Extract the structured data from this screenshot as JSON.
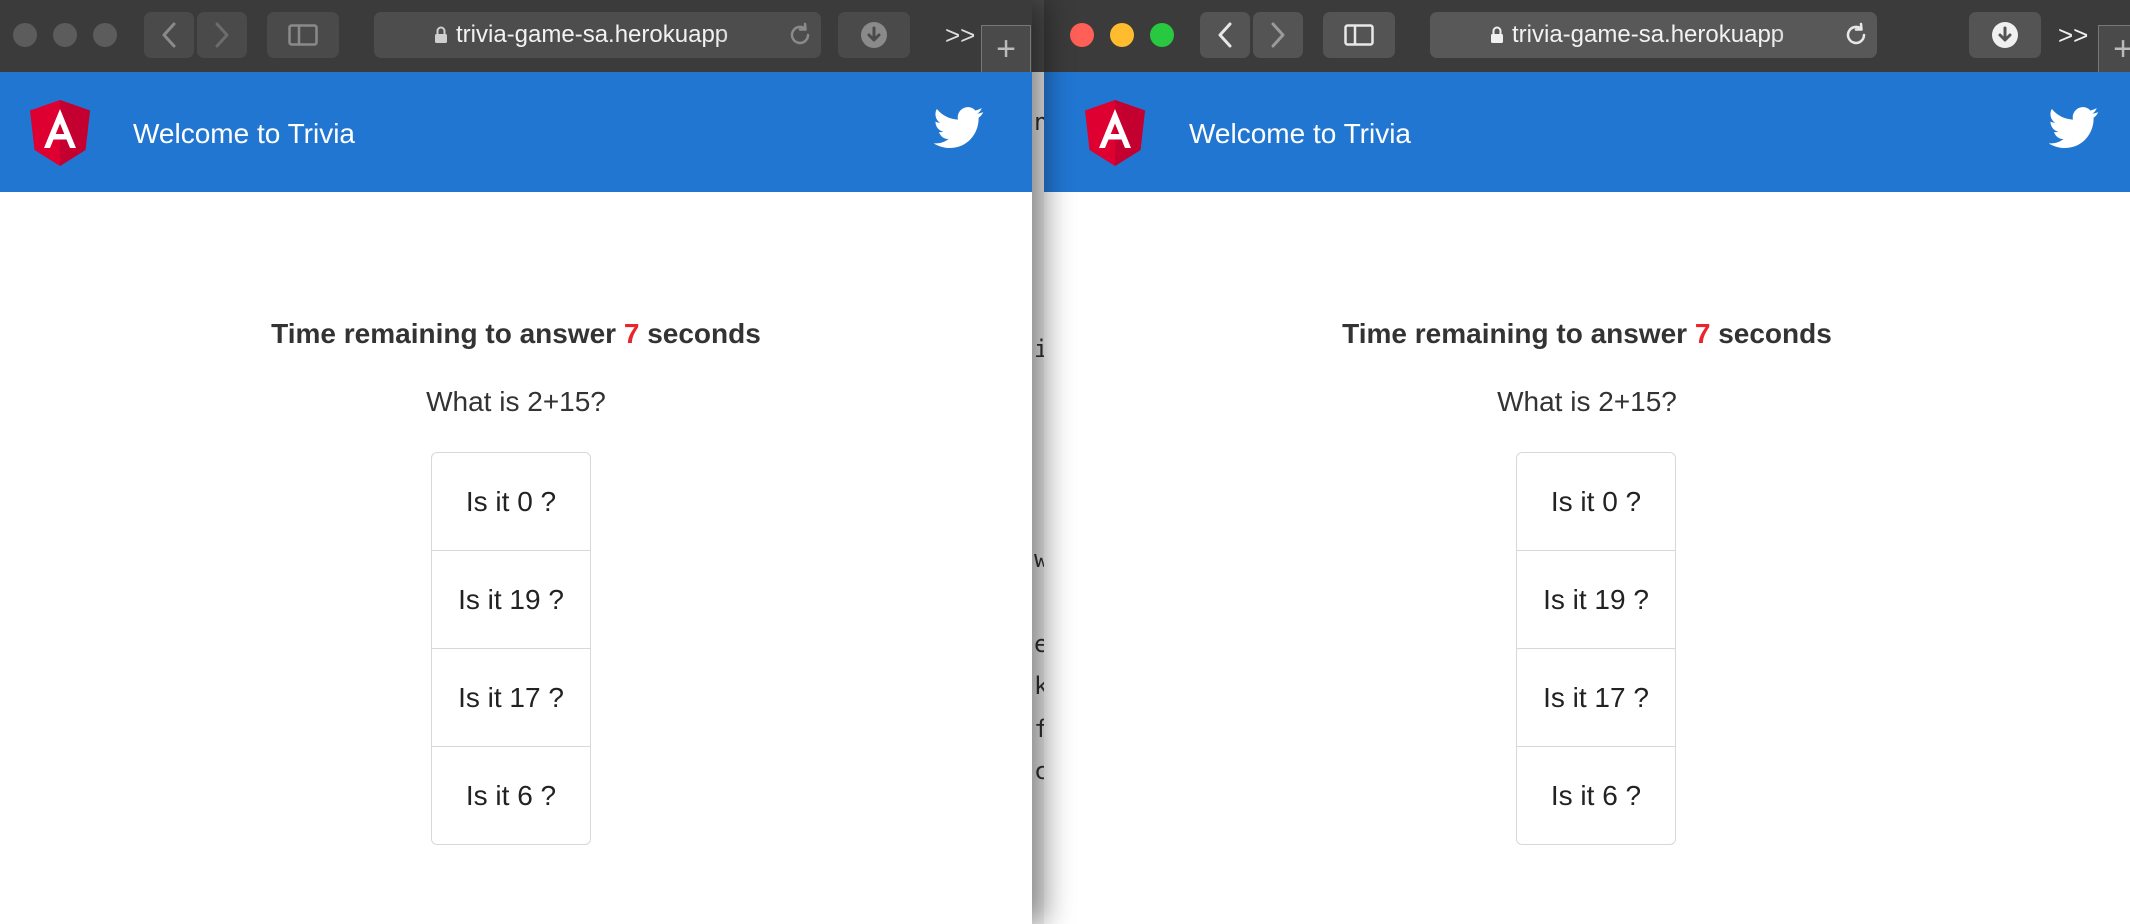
{
  "browser": {
    "url": "trivia-game-sa.herokuapp",
    "more_label": ">>",
    "new_tab_label": "+"
  },
  "app": {
    "title": "Welcome to Trivia",
    "logo_letter": "A",
    "header_color": "#2176d2",
    "logo_color": "#dd0031"
  },
  "game": {
    "timer_prefix": "Time remaining to answer",
    "timer_value": "7",
    "timer_suffix": "seconds",
    "timer_value_color": "#e8262b",
    "question": "What is 2+15?",
    "answers": [
      "Is it 0 ?",
      "Is it 19 ?",
      "Is it 17 ?",
      "Is it 6 ?"
    ]
  },
  "background_terminal": {
    "chars": [
      "n",
      "i",
      "w",
      "e",
      "k",
      "f",
      "c"
    ]
  }
}
